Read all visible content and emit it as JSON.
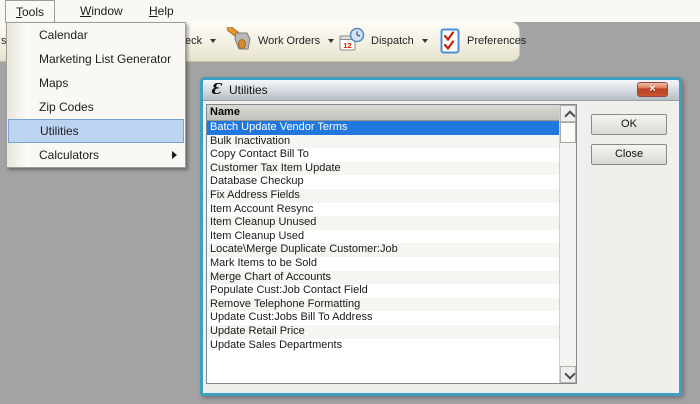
{
  "menubar": {
    "items": [
      {
        "label": "Tools",
        "state": "open"
      },
      {
        "label": "Window"
      },
      {
        "label": "Help"
      }
    ]
  },
  "tools_menu": {
    "items": [
      {
        "label": "Calendar"
      },
      {
        "label": "Marketing List Generator"
      },
      {
        "label": "Maps"
      },
      {
        "label": "Zip Codes"
      },
      {
        "label": "Utilities",
        "selected": true
      },
      {
        "label": "Calculators",
        "has_submenu": true
      }
    ]
  },
  "toolbar": {
    "clipped_left_fragment": "s",
    "buttons": [
      {
        "label": "eck",
        "partial": true,
        "has_dropdown": true
      },
      {
        "label": "Work Orders",
        "icon": "hammer",
        "has_dropdown": true
      },
      {
        "label": "Dispatch",
        "icon": "calendar-clock",
        "has_dropdown": true
      },
      {
        "label": "Preferences",
        "icon": "checklist",
        "has_dropdown": false
      }
    ],
    "dispatch_icon_number": "12"
  },
  "dialog": {
    "title": "Utilities",
    "app_icon_glyph": "Ɛ",
    "close_glyph": "×",
    "list": {
      "header": "Name",
      "selected_index": 0,
      "items": [
        "Batch Update Vendor Terms",
        "Bulk Inactivation",
        "Copy Contact Bill To",
        "Customer Tax Item Update",
        "Database Checkup",
        "Fix Address Fields",
        "Item Account Resync",
        "Item Cleanup Unused",
        "Item Cleanup Used",
        "Locate\\Merge Duplicate Customer:Job",
        "Mark Items to be Sold",
        "Merge Chart of Accounts",
        "Populate Cust:Job Contact Field",
        "Remove Telephone Formatting",
        "Update Cust:Jobs Bill To Address",
        "Update Retail Price",
        "Update Sales Departments"
      ]
    },
    "buttons": {
      "ok": "OK",
      "close": "Close"
    }
  },
  "colors": {
    "desktop_gray": "#a3a3a3",
    "toolbar_beige_top": "#fdfcf7",
    "toolbar_beige_bottom": "#e6e2cd",
    "menu_highlight_fill": "#bdd4f0",
    "menu_highlight_border": "#7aa2d4",
    "list_selection_blue": "#2277dd",
    "dialog_border_teal": "#3d9fc2",
    "close_button_red": "#cb5530"
  }
}
